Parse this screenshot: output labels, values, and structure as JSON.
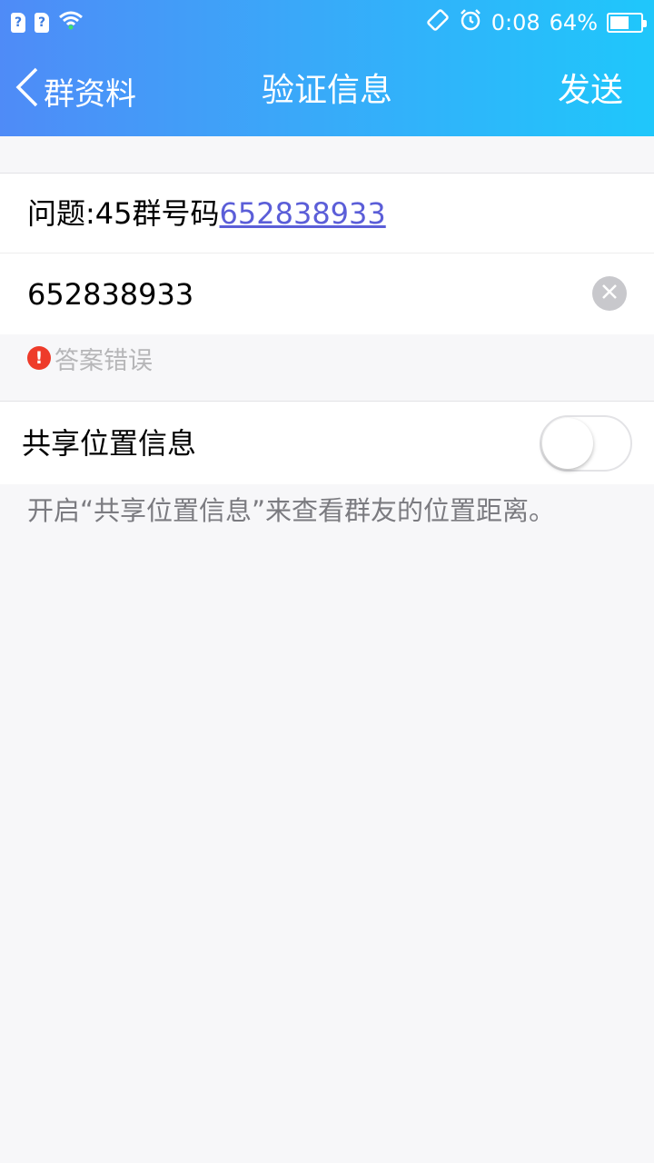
{
  "status_bar": {
    "sim1": "?",
    "sim2": "?",
    "time": "0:08",
    "battery": "64%",
    "battery_level": 0.64
  },
  "nav": {
    "back_label": "群资料",
    "title": "验证信息",
    "send_label": "发送"
  },
  "question": {
    "prefix": "问题:45群号码",
    "link": "652838933"
  },
  "answer": {
    "value": "652838933"
  },
  "error": {
    "icon": "!",
    "text": "答案错误"
  },
  "share_location": {
    "label": "共享位置信息",
    "enabled": false
  },
  "hint": "开启“共享位置信息”来查看群友的位置距离。",
  "colors": {
    "header_start": "#4f8bf7",
    "header_end": "#1fc7fb",
    "link": "#5b5ed8",
    "error": "#ee3b2a"
  }
}
